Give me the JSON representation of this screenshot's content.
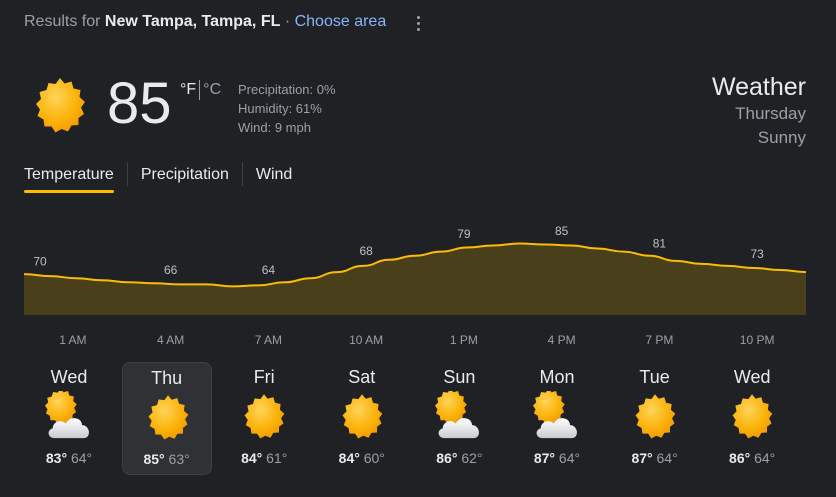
{
  "header": {
    "prefix": "Results for",
    "location": "New Tampa, Tampa, FL",
    "separator": "·",
    "choose_area": "Choose area"
  },
  "current": {
    "temp": "85",
    "unit_f": "°F",
    "unit_c": "°C",
    "precipitation": "Precipitation: 0%",
    "humidity": "Humidity: 61%",
    "wind": "Wind: 9 mph",
    "icon": "sun-icon"
  },
  "summary": {
    "title": "Weather",
    "day": "Thursday",
    "condition": "Sunny"
  },
  "tabs": [
    {
      "label": "Temperature",
      "active": true
    },
    {
      "label": "Precipitation",
      "active": false
    },
    {
      "label": "Wind",
      "active": false
    }
  ],
  "colors": {
    "accent": "#fbbc04",
    "link": "#8ab4f8",
    "chart_fill": "#4a3f1b",
    "background": "#202124"
  },
  "chart_data": {
    "type": "area",
    "x": [
      "1 AM",
      "4 AM",
      "7 AM",
      "10 AM",
      "1 PM",
      "4 PM",
      "7 PM",
      "10 PM"
    ],
    "values": [
      70,
      66,
      64,
      68,
      79,
      85,
      81,
      73
    ],
    "labels_shown": [
      "70",
      "66",
      "64",
      "68",
      "79",
      "85",
      "81",
      "73"
    ],
    "curve": [
      70,
      69,
      68,
      67,
      66,
      65.5,
      65,
      65,
      64,
      64.5,
      66,
      68,
      71,
      74,
      77,
      79,
      81,
      83,
      84,
      85,
      84.5,
      84,
      82.5,
      81,
      79,
      76.5,
      75,
      74,
      73,
      72,
      71
    ],
    "ylim": [
      50,
      95
    ],
    "grid": false
  },
  "days": [
    {
      "name": "Wed",
      "high": "83°",
      "low": "64°",
      "icon": "partly-cloudy-icon",
      "selected": false
    },
    {
      "name": "Thu",
      "high": "85°",
      "low": "63°",
      "icon": "sun-icon",
      "selected": true
    },
    {
      "name": "Fri",
      "high": "84°",
      "low": "61°",
      "icon": "sun-icon",
      "selected": false
    },
    {
      "name": "Sat",
      "high": "84°",
      "low": "60°",
      "icon": "sun-icon",
      "selected": false
    },
    {
      "name": "Sun",
      "high": "86°",
      "low": "62°",
      "icon": "partly-cloudy-icon",
      "selected": false
    },
    {
      "name": "Mon",
      "high": "87°",
      "low": "64°",
      "icon": "partly-cloudy-icon",
      "selected": false
    },
    {
      "name": "Tue",
      "high": "87°",
      "low": "64°",
      "icon": "sun-icon",
      "selected": false
    },
    {
      "name": "Wed",
      "high": "86°",
      "low": "64°",
      "icon": "sun-icon",
      "selected": false
    }
  ]
}
